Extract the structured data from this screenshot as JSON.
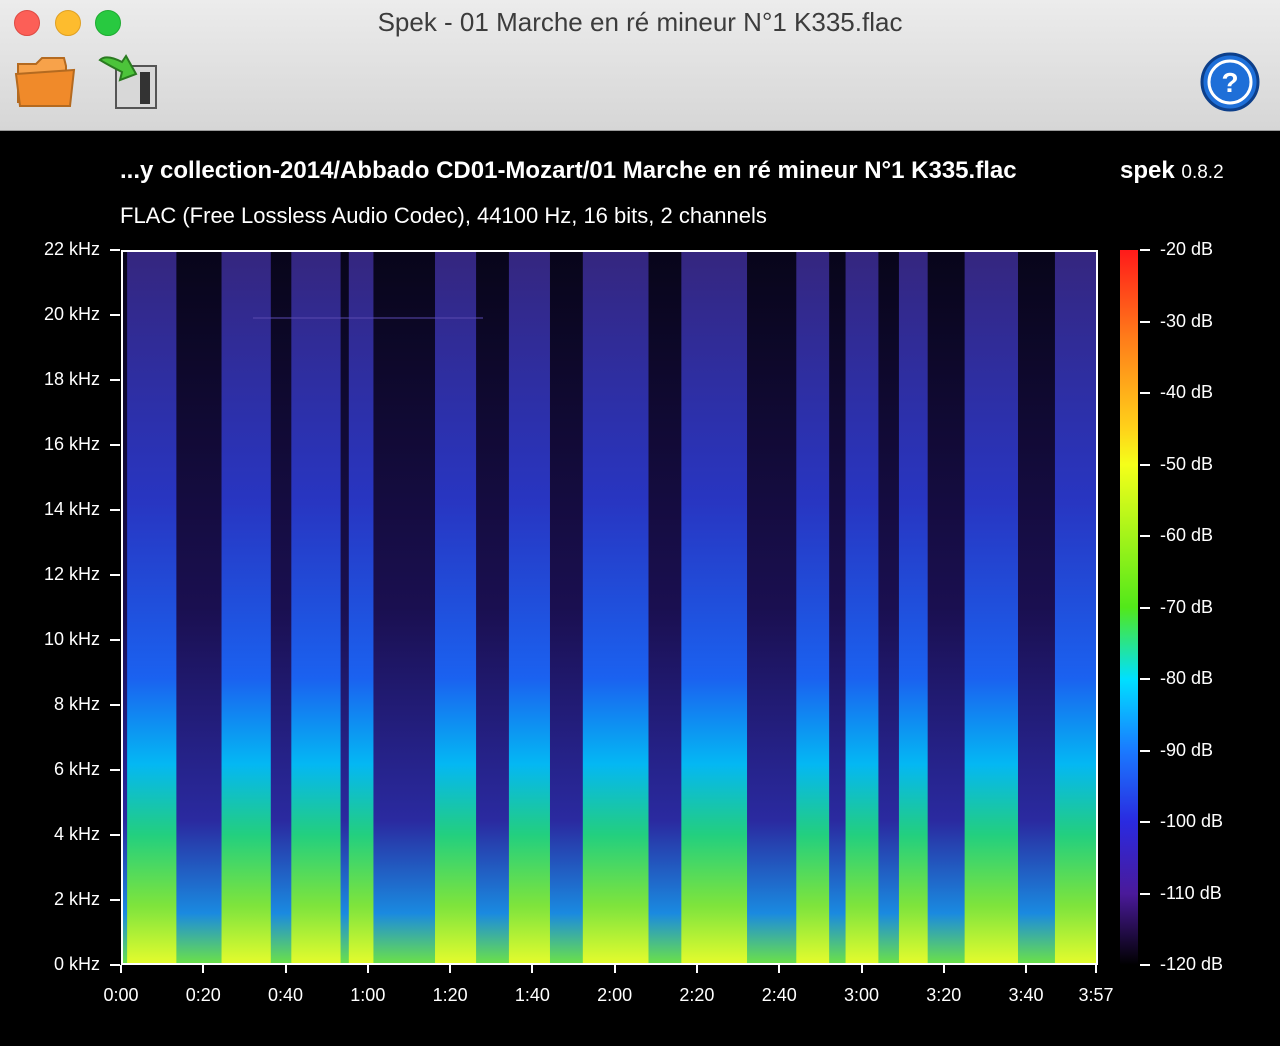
{
  "window": {
    "title": "Spek - 01 Marche en ré mineur N°1 K335.flac"
  },
  "toolbar": {
    "open_icon": "folder-icon",
    "save_icon": "export-icon",
    "help_icon": "help-icon"
  },
  "header": {
    "file_path": "...y collection-2014/Abbado CD01-Mozart/01 Marche en ré mineur N°1 K335.flac",
    "app_name": "spek",
    "app_version": "0.8.2",
    "info": "FLAC (Free Lossless Audio Codec), 44100 Hz, 16 bits, 2 channels"
  },
  "chart_data": {
    "type": "heatmap",
    "title": "...y collection-2014/Abbado CD01-Mozart/01 Marche en ré mineur N°1 K335.flac",
    "subtitle": "FLAC (Free Lossless Audio Codec), 44100 Hz, 16 bits, 2 channels",
    "x_ticks": [
      "0:00",
      "0:20",
      "0:40",
      "1:00",
      "1:20",
      "1:40",
      "2:00",
      "2:20",
      "2:40",
      "3:00",
      "3:20",
      "3:40",
      "3:57"
    ],
    "x_tick_seconds": [
      0,
      20,
      40,
      60,
      80,
      100,
      120,
      140,
      160,
      180,
      200,
      220,
      237
    ],
    "xlim": [
      0,
      237
    ],
    "y_ticks": [
      "22 kHz",
      "20 kHz",
      "18 kHz",
      "16 kHz",
      "14 kHz",
      "12 kHz",
      "10 kHz",
      "8 kHz",
      "6 kHz",
      "4 kHz",
      "2 kHz",
      "0 kHz"
    ],
    "y_tick_khz": [
      22,
      20,
      18,
      16,
      14,
      12,
      10,
      8,
      6,
      4,
      2,
      0
    ],
    "ylim": [
      0,
      22
    ],
    "colorbar_ticks": [
      "-20 dB",
      "-30 dB",
      "-40 dB",
      "-50 dB",
      "-60 dB",
      "-70 dB",
      "-80 dB",
      "-90 dB",
      "-100 dB",
      "-110 dB",
      "-120 dB"
    ],
    "colorbar_db": [
      -20,
      -30,
      -40,
      -50,
      -60,
      -70,
      -80,
      -90,
      -100,
      -110,
      -120
    ],
    "colorbar_range": [
      -120,
      -20
    ],
    "bright_segments": [
      [
        1,
        13
      ],
      [
        24,
        36
      ],
      [
        41,
        53
      ],
      [
        55,
        61
      ],
      [
        76,
        86
      ],
      [
        94,
        104
      ],
      [
        112,
        128
      ],
      [
        136,
        152
      ],
      [
        164,
        172
      ],
      [
        176,
        184
      ],
      [
        189,
        196
      ],
      [
        205,
        218
      ],
      [
        227,
        237
      ]
    ]
  }
}
